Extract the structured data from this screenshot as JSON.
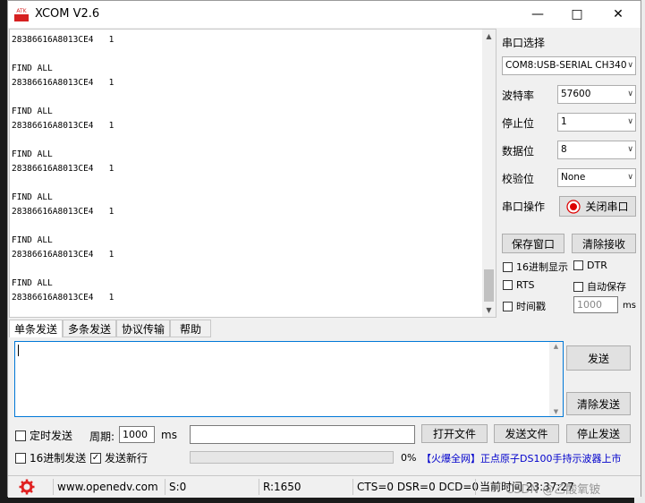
{
  "window": {
    "title": "XCOM V2.6",
    "logo_text": "ATK"
  },
  "receive": {
    "lines": [
      "28386616A8013CE4   1",
      "",
      "FIND ALL",
      "28386616A8013CE4   1",
      "",
      "FIND ALL",
      "28386616A8013CE4   1",
      "",
      "FIND ALL",
      "28386616A8013CE4   1",
      "",
      "FIND ALL",
      "28386616A8013CE4   1",
      "",
      "FIND ALL",
      "28386616A8013CE4   1",
      "",
      "FIND ALL",
      "28386616A8013CE4   1"
    ]
  },
  "serial": {
    "port_label": "串口选择",
    "port_value": "COM8:USB-SERIAL CH340",
    "baud_label": "波特率",
    "baud_value": "57600",
    "stop_label": "停止位",
    "stop_value": "1",
    "data_label": "数据位",
    "data_value": "8",
    "parity_label": "校验位",
    "parity_value": "None",
    "op_label": "串口操作",
    "close_port_label": "关闭串口"
  },
  "options": {
    "save_window": "保存窗口",
    "clear_receive": "清除接收",
    "hex_display": "16进制显示",
    "dtr": "DTR",
    "rts": "RTS",
    "auto_save": "自动保存",
    "timestamp": "时间戳",
    "timestamp_value": "1000",
    "ms": "ms"
  },
  "tabs": [
    "单条发送",
    "多条发送",
    "协议传输",
    "帮助"
  ],
  "send": {
    "send_label": "发送",
    "clear_send_label": "清除发送",
    "timed_send": "定时发送",
    "period_label": "周期:",
    "period_value": "1000",
    "period_unit": "ms",
    "open_file": "打开文件",
    "send_file": "发送文件",
    "stop_send": "停止发送",
    "hex_send": "16进制发送",
    "send_newline": "发送新行",
    "progress_text": "0%",
    "progress_value": 0,
    "ad_text": "【火爆全网】正点原子DS100手持示波器上市"
  },
  "status": {
    "url": "www.openedv.com",
    "sent": "S:0",
    "received": "R:1650",
    "lines": "CTS=0 DSR=0 DCD=0",
    "time": "当前时间 23:37:27",
    "watermark": "CSDN @乙酸氧铍"
  }
}
